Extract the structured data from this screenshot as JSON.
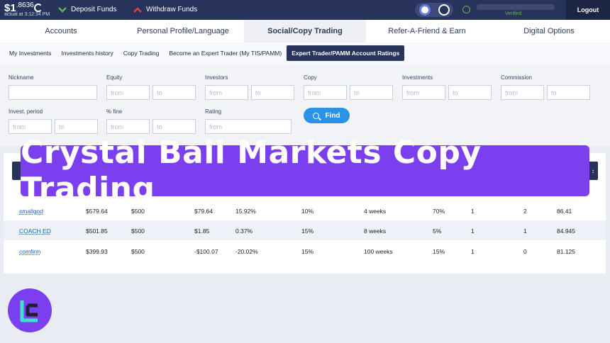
{
  "topbar": {
    "balance_main": "$1",
    "balance_sup": ".8636",
    "balance_sub": "actual at 3:12:34 PM",
    "deposit_label": "Deposit Funds",
    "withdraw_label": "Withdraw Funds",
    "verified_label": "Verified",
    "logout_label": "Logout",
    "deposit_color": "#5fb35a",
    "withdraw_color": "#e0453e"
  },
  "main_tabs": [
    "Accounts",
    "Personal Profile/Language",
    "Social/Copy Trading",
    "Refer-A-Friend & Earn",
    "Digital Options"
  ],
  "main_tab_active": "Social/Copy Trading",
  "sub_tabs": [
    "My Investments",
    "Investments history",
    "Copy Trading",
    "Become an Expert Trader (My TIS/PAMM)",
    "Expert Trader/PAMM Account Ratings"
  ],
  "sub_tab_active": "Expert Trader/PAMM Account Ratings",
  "filters": {
    "nickname": "Nickname",
    "equity": "Equity",
    "investors": "Investors",
    "copy": "Copy",
    "investments": "Investments",
    "commission": "Commission",
    "invest_period": "Invest. period",
    "pct_fine": "% fine",
    "rating": "Rating",
    "from": "from",
    "to": "to",
    "find_label": "Find"
  },
  "rows": [
    {
      "name": "smallgod",
      "equity": "$579.64",
      "initial": "$500",
      "profit": "$79.64",
      "pct": "15.92%",
      "commission": "10%",
      "period": "4 weeks",
      "fine": "70%",
      "investors": "1",
      "copy": "2",
      "rating": "86.41"
    },
    {
      "name": "COACH ED",
      "equity": "$501.85",
      "initial": "$500",
      "profit": "$1.85",
      "pct": "0.37%",
      "commission": "15%",
      "period": "8 weeks",
      "fine": "5%",
      "investors": "1",
      "copy": "1",
      "rating": "84.945"
    },
    {
      "name": "comfirm",
      "equity": "$399.93",
      "initial": "$500",
      "profit": "-$100.07",
      "pct": "-20.02%",
      "commission": "15%",
      "period": "100 weeks",
      "fine": "15%",
      "investors": "1",
      "copy": "0",
      "rating": "81.125"
    }
  ],
  "banner": {
    "text": "Crystal Ball Markets Copy Trading",
    "color": "#7b3ff0"
  }
}
